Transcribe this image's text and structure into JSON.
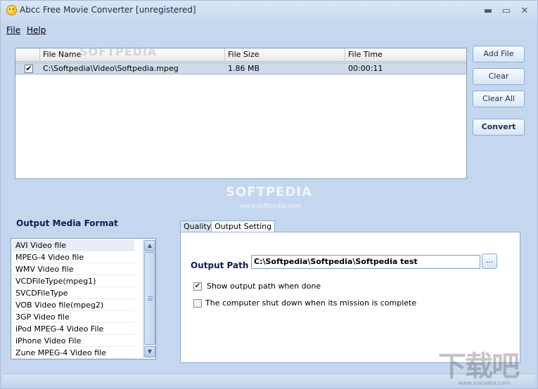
{
  "window": {
    "title": "Abcc Free Movie Converter  [unregistered]",
    "minimize_glyph": "▬",
    "maximize_glyph": "▭",
    "close_glyph": "✕",
    "app_icon": "smiley-icon"
  },
  "menu": {
    "items": [
      {
        "label": "File"
      },
      {
        "label": "Help"
      }
    ]
  },
  "file_table": {
    "columns": [
      "",
      "File Name",
      "File Size",
      "File Time"
    ],
    "rows": [
      {
        "checked": "✔",
        "name": "C:\\Softpedia\\Video\\Softpedia.mpeg",
        "size": "1.86 MB",
        "time": "00:00:11"
      }
    ]
  },
  "buttons": {
    "add_file": "Add File",
    "clear": "Clear",
    "clear_all": "Clear All",
    "convert": "Convert"
  },
  "watermark": {
    "main": "SOFTPEDIA",
    "url": "www.softpedia.com",
    "top": "SOFTPEDIA",
    "corner": "下载吧",
    "corner_url": "www.xiazaiba.com"
  },
  "output_format": {
    "title": "Output Media Format",
    "items": [
      "AVI Video file",
      "MPEG-4 Video file",
      "WMV Video file",
      "VCDFileType(mpeg1)",
      "SVCDFileType",
      "VOB Video file(mpeg2)",
      "3GP Video file",
      "iPod MPEG-4 Video File",
      "iPhone Video File",
      "Zune MPEG-4 Video file"
    ],
    "selected_index": 0,
    "scroll_up": "▲",
    "scroll_down": "▼"
  },
  "tabs": [
    {
      "label": "Quality"
    },
    {
      "label": "Output Setting"
    }
  ],
  "output_setting": {
    "path_label": "Output Path",
    "path_value": "C:\\Softpedia\\Softpedia\\Softpedia test",
    "browse_label": "...",
    "show_path_label": "Show output path when done",
    "show_path_checked": "✔",
    "shutdown_label": "The computer shut down when its mission is complete",
    "shutdown_checked": ""
  }
}
